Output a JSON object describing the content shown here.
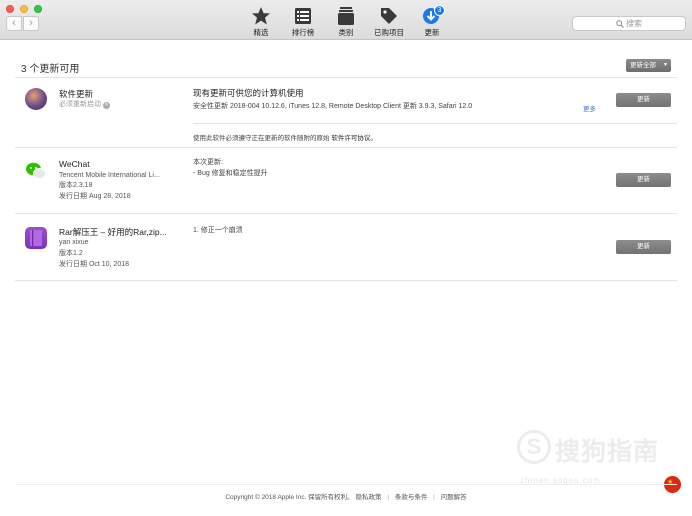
{
  "toolbar": {
    "items": [
      {
        "label": "精选",
        "icon": "star-icon"
      },
      {
        "label": "排行榜",
        "icon": "list-icon"
      },
      {
        "label": "类别",
        "icon": "stack-icon"
      },
      {
        "label": "已购项目",
        "icon": "tag-icon"
      },
      {
        "label": "更新",
        "icon": "download-arrow-icon",
        "badge": "3"
      }
    ],
    "search_placeholder": "搜索",
    "back": "‹",
    "forward": "›"
  },
  "updates": {
    "title": "3 个更新可用",
    "update_all": "更新全部",
    "software_update": {
      "name": "软件更新",
      "subtitle": "必须重新启动",
      "heading": "现有更新可供您的计算机使用",
      "detail": "安全性更新 2018-004 10.12.6, iTunes 12.8, Remote Desktop Client 更新 3.9.3, Safari 12.0",
      "more": "更多",
      "button": "更新",
      "license_prefix": "使用此软件必须遵守正在更新的软件随附的原始",
      "license_link": "软件许可协议",
      "license_suffix": "。"
    },
    "apps": [
      {
        "name": "WeChat",
        "developer": "Tencent Mobile International Li...",
        "version": "版本2.3.18",
        "release": "发行日期 Aug 28, 2018",
        "notes": [
          "本次更新:",
          "- Bug 修复和稳定性提升"
        ],
        "button": "更新",
        "icon": "wechat-icon"
      },
      {
        "name": "Rar解压王 – 好用的Rar,zip...",
        "developer": "yan xixue",
        "version": "版本1.2",
        "release": "发行日期 Oct 10, 2018",
        "notes": [
          "1. 修正一个崩溃"
        ],
        "button": "更新",
        "icon": "rar-book-icon"
      }
    ]
  },
  "footer": {
    "copyright": "Copyright © 2018 Apple Inc. 保留所有权利。",
    "privacy": "隐私政策",
    "terms": "条款与条件",
    "faq": "问题解答",
    "separator": "|"
  },
  "watermark": {
    "logo": "S",
    "text": "搜狗指南",
    "url": "zhinan.sogou.com"
  },
  "colors": {
    "accent": "#1b7ae6",
    "button_gray": "#7c7c7c",
    "link": "#3b75c9",
    "traffic_red": "#fc605b",
    "traffic_yellow": "#fdbc40",
    "traffic_green": "#34c84a"
  }
}
